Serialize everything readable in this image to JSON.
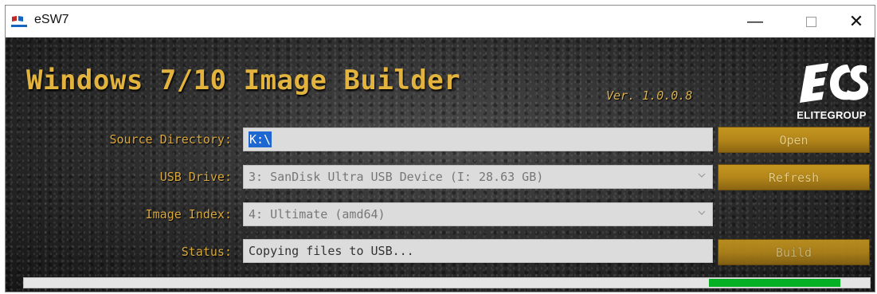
{
  "window": {
    "title": "eSW7",
    "icon": "ecs-flag-icon",
    "controls": [
      "minimize-icon",
      "maximize-icon",
      "close-icon"
    ],
    "minimize_glyph": "—",
    "close_glyph": "✕"
  },
  "header": {
    "app_title": "Windows 7/10 Image Builder",
    "version": "Ver. 1.0.0.8",
    "brand_logo_text": "ECS",
    "brand_name": "ELITEGROUP"
  },
  "form": {
    "source_directory": {
      "label": "Source Directory:",
      "value": "K:\\"
    },
    "usb_drive": {
      "label": "USB Drive:",
      "value": "3: SanDisk Ultra USB Device (I: 28.63 GB)"
    },
    "image_index": {
      "label": "Image Index:",
      "value": "4: Ultimate (amd64)"
    },
    "status": {
      "label": "Status:",
      "value": "Copying files to USB..."
    }
  },
  "buttons": {
    "open": "Open",
    "refresh": "Refresh",
    "build": "Build"
  },
  "progress": {
    "value": 0.965,
    "indicator_start": 0.81,
    "color": "#06b025"
  },
  "colors": {
    "accent_gold": "#e2b33d",
    "button_gold": "#b4861a",
    "field_bg": "#dcdcdc",
    "selection_blue": "#1e66d0"
  }
}
